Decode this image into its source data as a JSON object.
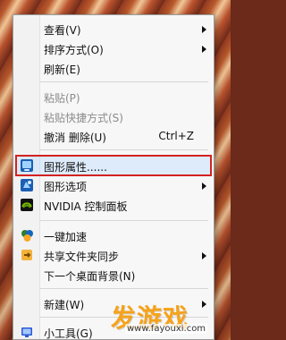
{
  "context_menu": {
    "items": [
      {
        "label": "查看(V)",
        "submenu": true
      },
      {
        "label": "排序方式(O)",
        "submenu": true
      },
      {
        "label": "刷新(E)"
      },
      {
        "label": "粘贴(P)",
        "disabled": true
      },
      {
        "label": "粘贴快捷方式(S)",
        "disabled": true
      },
      {
        "label": "撤消 删除(U)",
        "shortcut": "Ctrl+Z"
      },
      {
        "label": "图形属性......",
        "icon": "graphics-properties-icon",
        "highlighted": true
      },
      {
        "label": "图形选项",
        "icon": "graphics-options-icon",
        "submenu": true
      },
      {
        "label": "NVIDIA 控制面板",
        "icon": "nvidia-icon"
      },
      {
        "label": "一键加速",
        "icon": "speedup-icon"
      },
      {
        "label": "共享文件夹同步",
        "icon": "share-sync-icon",
        "submenu": true
      },
      {
        "label": "下一个桌面背景(N)"
      },
      {
        "label": "新建(W)",
        "submenu": true
      },
      {
        "label": "小工具(G)",
        "icon": "gadgets-icon"
      }
    ]
  },
  "watermark": {
    "main": "发游戏",
    "sub": "www.fayouxi.com"
  },
  "colors": {
    "highlight_border": "#d32222",
    "watermark": "#f6a21a"
  }
}
